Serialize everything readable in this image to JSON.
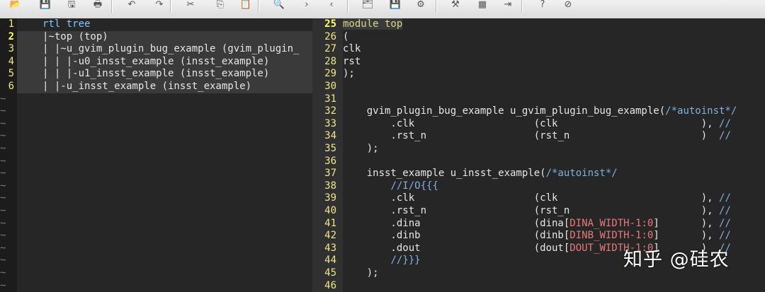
{
  "toolbar": {
    "buttons": [
      {
        "name": "open-file-icon",
        "glyph": "📂"
      },
      {
        "name": "save-icon",
        "glyph": "💾"
      },
      {
        "name": "save-all-icon",
        "glyph": "🖫"
      },
      {
        "name": "print-icon",
        "glyph": "🖶"
      },
      {
        "name": "undo-icon",
        "glyph": "↶"
      },
      {
        "name": "redo-icon",
        "glyph": "↷"
      },
      {
        "name": "cut-icon",
        "glyph": "✂"
      },
      {
        "name": "copy-icon",
        "glyph": "⎘"
      },
      {
        "name": "paste-icon",
        "glyph": "📋"
      },
      {
        "name": "find-replace-icon",
        "glyph": "🔍"
      },
      {
        "name": "find-next-icon",
        "glyph": "›"
      },
      {
        "name": "find-prev-icon",
        "glyph": "‹"
      },
      {
        "name": "load-session-icon",
        "glyph": "🗂"
      },
      {
        "name": "save-session-icon",
        "glyph": "💾"
      },
      {
        "name": "run-script-icon",
        "glyph": "⚙"
      },
      {
        "name": "make-icon",
        "glyph": "⚒"
      },
      {
        "name": "build-tags-icon",
        "glyph": "▦"
      },
      {
        "name": "jump-tag-icon",
        "glyph": "⇥"
      },
      {
        "name": "help-icon",
        "glyph": "?"
      },
      {
        "name": "find-help-icon",
        "glyph": "⊘"
      }
    ]
  },
  "left_pane": {
    "lines": [
      {
        "num": "1",
        "text": "rtl tree"
      },
      {
        "num": "2",
        "text": "|~top (top)"
      },
      {
        "num": "3",
        "text": "| |~u_gvim_plugin_bug_example (gvim_plugin_"
      },
      {
        "num": "4",
        "text": "| | |-u0_insst_example (insst_example)"
      },
      {
        "num": "5",
        "text": "| | |-u1_insst_example (insst_example)"
      },
      {
        "num": "6",
        "text": "| |-u_insst_example (insst_example)"
      }
    ],
    "tilde": "~"
  },
  "right_pane": {
    "lines": [
      {
        "num": "25",
        "text": "module top"
      },
      {
        "num": "26",
        "text": "("
      },
      {
        "num": "27",
        "text": "clk"
      },
      {
        "num": "28",
        "text": "rst"
      },
      {
        "num": "29",
        "text": ");"
      },
      {
        "num": "30",
        "text": ""
      },
      {
        "num": "31",
        "text": ""
      },
      {
        "num": "32",
        "text": "    gvim_plugin_bug_example u_gvim_plugin_bug_example(/*autoinst*/"
      },
      {
        "num": "33",
        "text": "        .clk                    (clk                        ), //"
      },
      {
        "num": "34",
        "text": "        .rst_n                  (rst_n                      )  //"
      },
      {
        "num": "35",
        "text": "    );"
      },
      {
        "num": "36",
        "text": ""
      },
      {
        "num": "37",
        "text": "    insst_example u_insst_example(/*autoinst*/"
      },
      {
        "num": "38",
        "text": "        //I/O{{{"
      },
      {
        "num": "39",
        "text": "        .clk                    (clk                        ), //"
      },
      {
        "num": "40",
        "text": "        .rst_n                  (rst_n                      ), //"
      },
      {
        "num": "41",
        "text": "        .dina                   (dina[DINA_WIDTH-1:0]       ), //"
      },
      {
        "num": "42",
        "text": "        .dinb                   (dinb[DINB_WIDTH-1:0]       ), //"
      },
      {
        "num": "43",
        "text": "        .dout                   (dout[DOUT_WIDTH-1:0]       )  //"
      },
      {
        "num": "44",
        "text": "        //}}}"
      },
      {
        "num": "45",
        "text": "    );"
      },
      {
        "num": "46",
        "text": ""
      }
    ]
  },
  "watermark": "知乎 @硅农",
  "colors": {
    "line_number": "#f0e68c",
    "keyword_blue": "#7ec8ff",
    "keyword_olive": "#d7d787",
    "comment": "#7fb0e0",
    "range": "#e8787a"
  }
}
